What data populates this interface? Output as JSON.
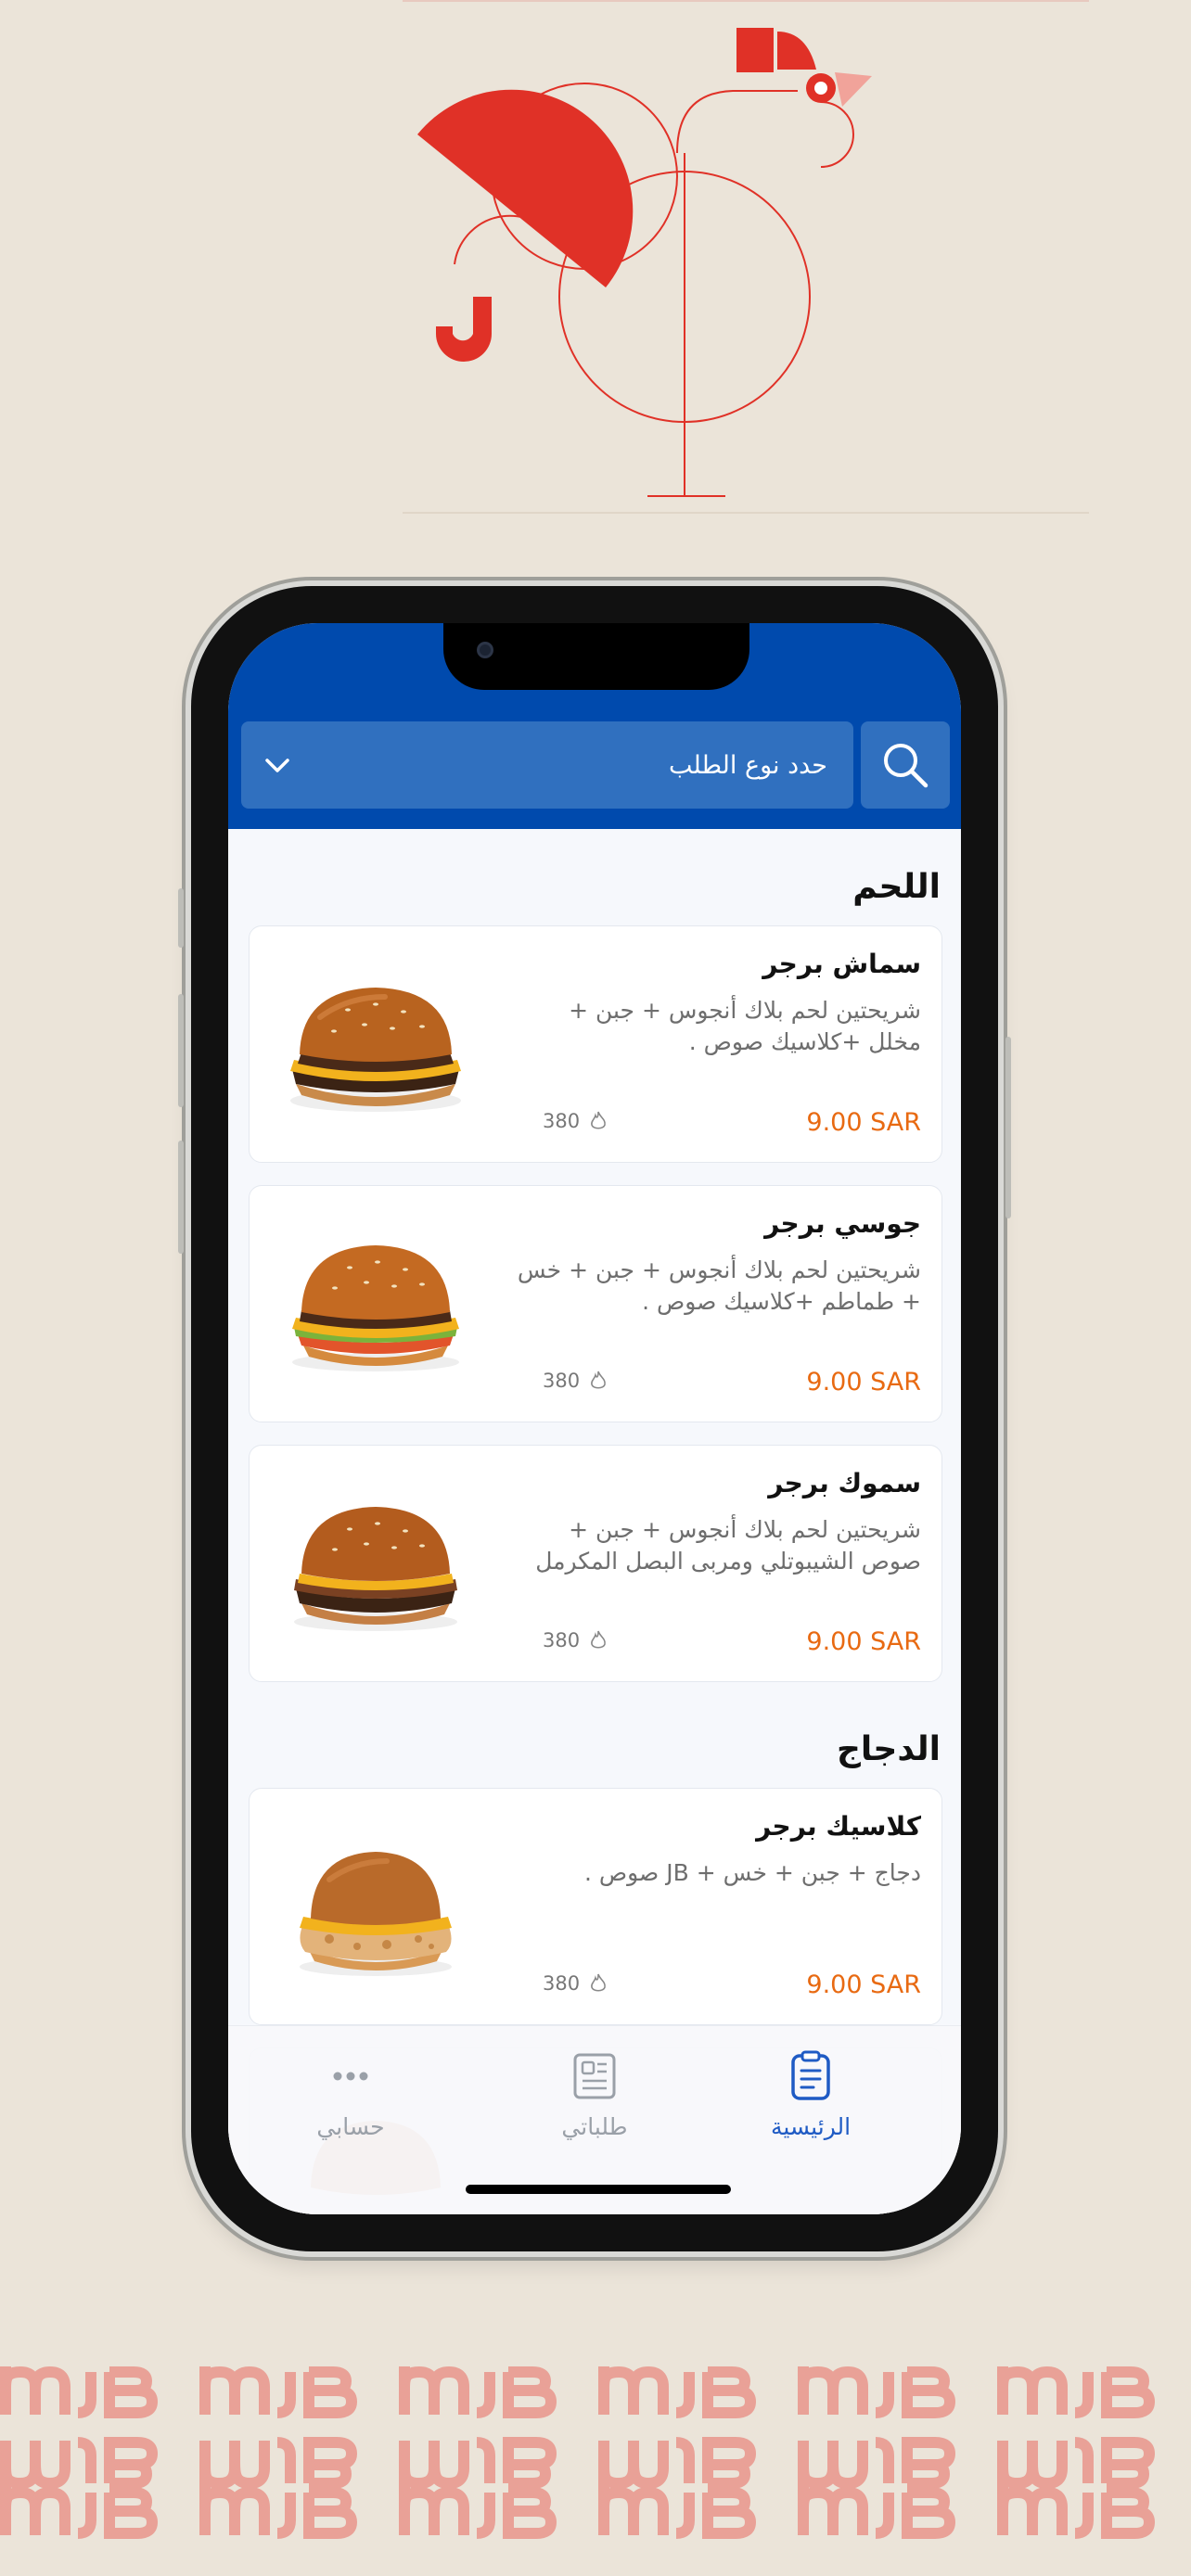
{
  "header": {
    "order_type_placeholder": "حدد نوع الطلب",
    "search_icon": "search-icon",
    "dropdown_icon": "chevron-down-icon"
  },
  "sections": [
    {
      "title": "اللحم",
      "items": [
        {
          "name": "سماش برجر",
          "description": "شريحتين لحم بلاك أنجوس + جبن + مخلل +كلاسيك صوص .",
          "price": "9.00 SAR",
          "calories": "380"
        },
        {
          "name": "جوسي برجر",
          "description": "شريحتين لحم بلاك أنجوس + جبن + خس + طماطم +كلاسيك صوص .",
          "price": "9.00 SAR",
          "calories": "380"
        },
        {
          "name": "سموك برجر",
          "description": "شريحتين لحم بلاك أنجوس + جبن + صوص الشيبوتلي ومربى البصل المكرمل",
          "price": "9.00 SAR",
          "calories": "380"
        }
      ]
    },
    {
      "title": "الدجاج",
      "items": [
        {
          "name": "كلاسيك برجر",
          "description": "دجاج + جبن + خس + JB صوص .",
          "price": "9.00 SAR",
          "calories": "380"
        }
      ]
    }
  ],
  "tabbar": {
    "home": {
      "label": "الرئيسية",
      "icon": "menu-clipboard-icon",
      "active": true
    },
    "orders": {
      "label": "طلباتي",
      "icon": "receipt-icon",
      "active": false
    },
    "account": {
      "label": "حسابي",
      "icon": "more-dots-icon",
      "active": false
    }
  },
  "colors": {
    "brand_blue": "#004aad",
    "select_blue": "#3070bf",
    "price_orange": "#e86a12",
    "logo_red": "#e03127",
    "pattern_pink": "#e9a197",
    "background": "#ebe4d9"
  }
}
